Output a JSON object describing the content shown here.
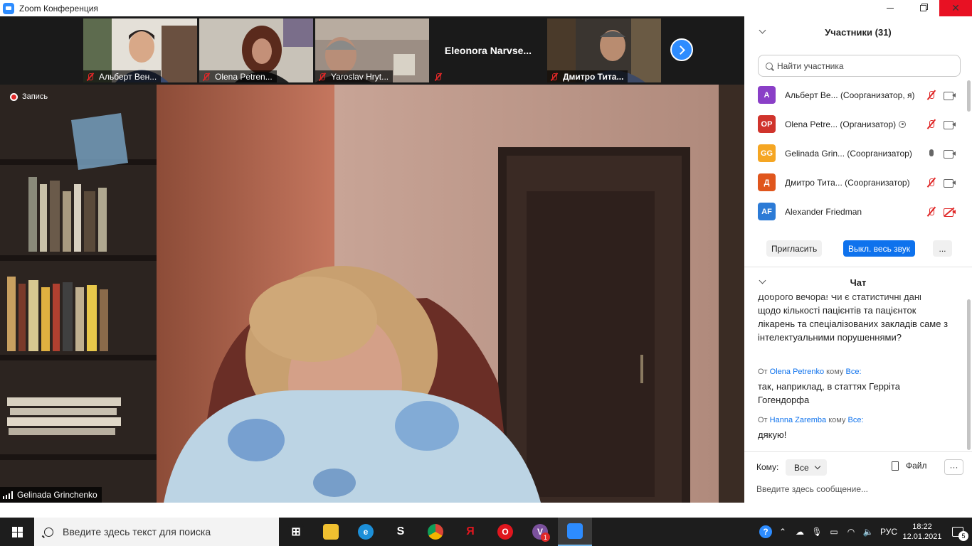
{
  "window": {
    "title": "Zoom Конференция",
    "minimize_icon": "minimize-icon",
    "maximize_icon": "restore-icon",
    "close_icon": "close-icon"
  },
  "thumbnails": [
    {
      "name": "Альберт Вен...",
      "muted": true
    },
    {
      "name": "Olena Petren...",
      "muted": true
    },
    {
      "name": "Yaroslav Hryt...",
      "muted": true
    },
    {
      "name": "",
      "center_name": "Eleonora  Narvse...",
      "muted": true
    },
    {
      "name": "Дмитро Тита...",
      "muted": true
    }
  ],
  "main_video": {
    "recording_label": "Запись",
    "speaker_name": "Gelinada Grinchenko"
  },
  "participants": {
    "header": "Участники (31)",
    "search_placeholder": "Найти участника",
    "list": [
      {
        "initials": "A",
        "name": "Альберт Ве...",
        "role": "(Соорганизатор, я)",
        "color": "#8A3FC7",
        "mic": "muted",
        "cam": "on",
        "sharing": false
      },
      {
        "initials": "OP",
        "name": "Olena Petre...",
        "role": "(Организатор)",
        "color": "#D0342C",
        "mic": "muted",
        "cam": "on",
        "sharing": true
      },
      {
        "initials": "GG",
        "name": "Gelinada Grin...",
        "role": "(Соорганизатор)",
        "color": "#F5A623",
        "mic": "on",
        "cam": "on",
        "sharing": false
      },
      {
        "initials": "Д",
        "name": "Дмитро Тита...",
        "role": "(Соорганизатор)",
        "color": "#E0561D",
        "mic": "muted",
        "cam": "on",
        "sharing": false
      },
      {
        "initials": "AF",
        "name": "Alexander Friedman",
        "role": "",
        "color": "#2C7BD6",
        "mic": "muted",
        "cam": "off",
        "sharing": false
      }
    ],
    "invite_label": "Пригласить",
    "mute_all_label": "Выкл. весь звук",
    "more_label": "..."
  },
  "chat": {
    "header": "Чат",
    "partial_top": "Доброго вечора! Чи є статистичні дані",
    "messages": [
      {
        "text": "щодо кількості пацієнтів та пацієнток лікарень та спеціалізованих закладів саме з інтелектуальними порушеннями?"
      },
      {
        "from_prefix": "От",
        "sender": "Olena Petrenko",
        "to_prefix": "кому",
        "to": "Все:",
        "text": "так, наприклад, в статтях Геррiта Гогендорфа"
      },
      {
        "from_prefix": "От",
        "sender": "Hanna Zaremba",
        "to_prefix": "кому",
        "to": "Все:",
        "text": "дякую!"
      }
    ],
    "to_label": "Кому:",
    "to_value": "Все",
    "file_label": "Файл",
    "more_label": "···",
    "input_placeholder": "Введите здесь сообщение..."
  },
  "taskbar": {
    "search_placeholder": "Введите здесь текст для поиска",
    "apps": [
      {
        "icon": "task-view-icon",
        "label": "⊞",
        "color": "#1d1d1d"
      },
      {
        "icon": "file-explorer-icon",
        "label": "",
        "color": "#F0C030"
      },
      {
        "icon": "edge-icon",
        "label": "e",
        "color": "#1C8FD8"
      },
      {
        "icon": "app-s-icon",
        "label": "S",
        "color": "#1d1d1d"
      },
      {
        "icon": "chrome-icon",
        "label": "",
        "color": "#DB4437"
      },
      {
        "icon": "yandex-icon",
        "label": "Я",
        "color": "#1d1d1d"
      },
      {
        "icon": "opera-icon",
        "label": "O",
        "color": "#E0161E"
      },
      {
        "icon": "viber-icon",
        "label": "V",
        "color": "#7B519D",
        "badge": "1"
      },
      {
        "icon": "zoom-icon",
        "label": "",
        "color": "#2D8CFF"
      }
    ],
    "language": "РУС",
    "time": "18:22",
    "date": "12.01.2021",
    "notifications": "5"
  }
}
